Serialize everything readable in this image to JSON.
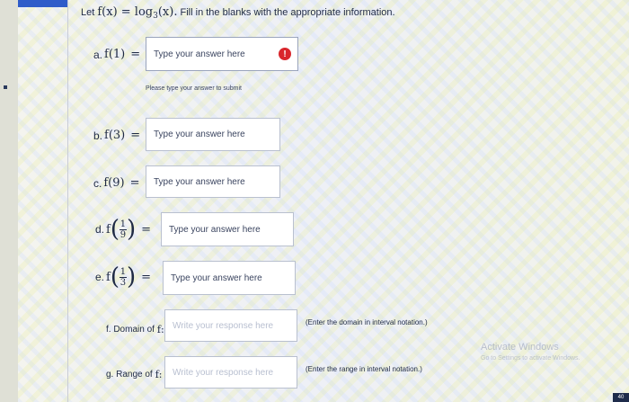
{
  "header": {
    "prefix": "Let",
    "function_def": "f(x) = log",
    "base": "3",
    "argument": "(x).",
    "instruction": "Fill in the blanks with the appropriate information."
  },
  "questions": {
    "a": {
      "label": "a.",
      "expr": "f(1)",
      "eq": "=",
      "placeholder": "Type your answer here",
      "error_hint": "Please type your answer to submit"
    },
    "b": {
      "label": "b.",
      "expr": "f(3)",
      "eq": "=",
      "placeholder": "Type your answer here"
    },
    "c": {
      "label": "c.",
      "expr": "f(9)",
      "eq": "=",
      "placeholder": "Type your answer here"
    },
    "d": {
      "label": "d.",
      "fn": "f",
      "num": "1",
      "den": "9",
      "eq": "=",
      "placeholder": "Type your answer here"
    },
    "e": {
      "label": "e.",
      "fn": "f",
      "num": "1",
      "den": "3",
      "eq": "=",
      "placeholder": "Type your answer here"
    },
    "f": {
      "label": "f. Domain of",
      "fn": "f:",
      "placeholder": "Write your response here",
      "note": "(Enter the domain in interval notation.)"
    },
    "g": {
      "label": "g. Range of",
      "fn": "f:",
      "placeholder": "Write your response here",
      "note": "(Enter the range in interval notation.)"
    }
  },
  "error_icon_glyph": "!",
  "watermark": {
    "title": "Activate Windows",
    "subtitle": "Go to Settings to activate Windows."
  },
  "corner": {
    "badge": "40"
  },
  "colors": {
    "error": "#d9262c",
    "tab": "#2f5cc9",
    "text": "#1f2a44"
  }
}
